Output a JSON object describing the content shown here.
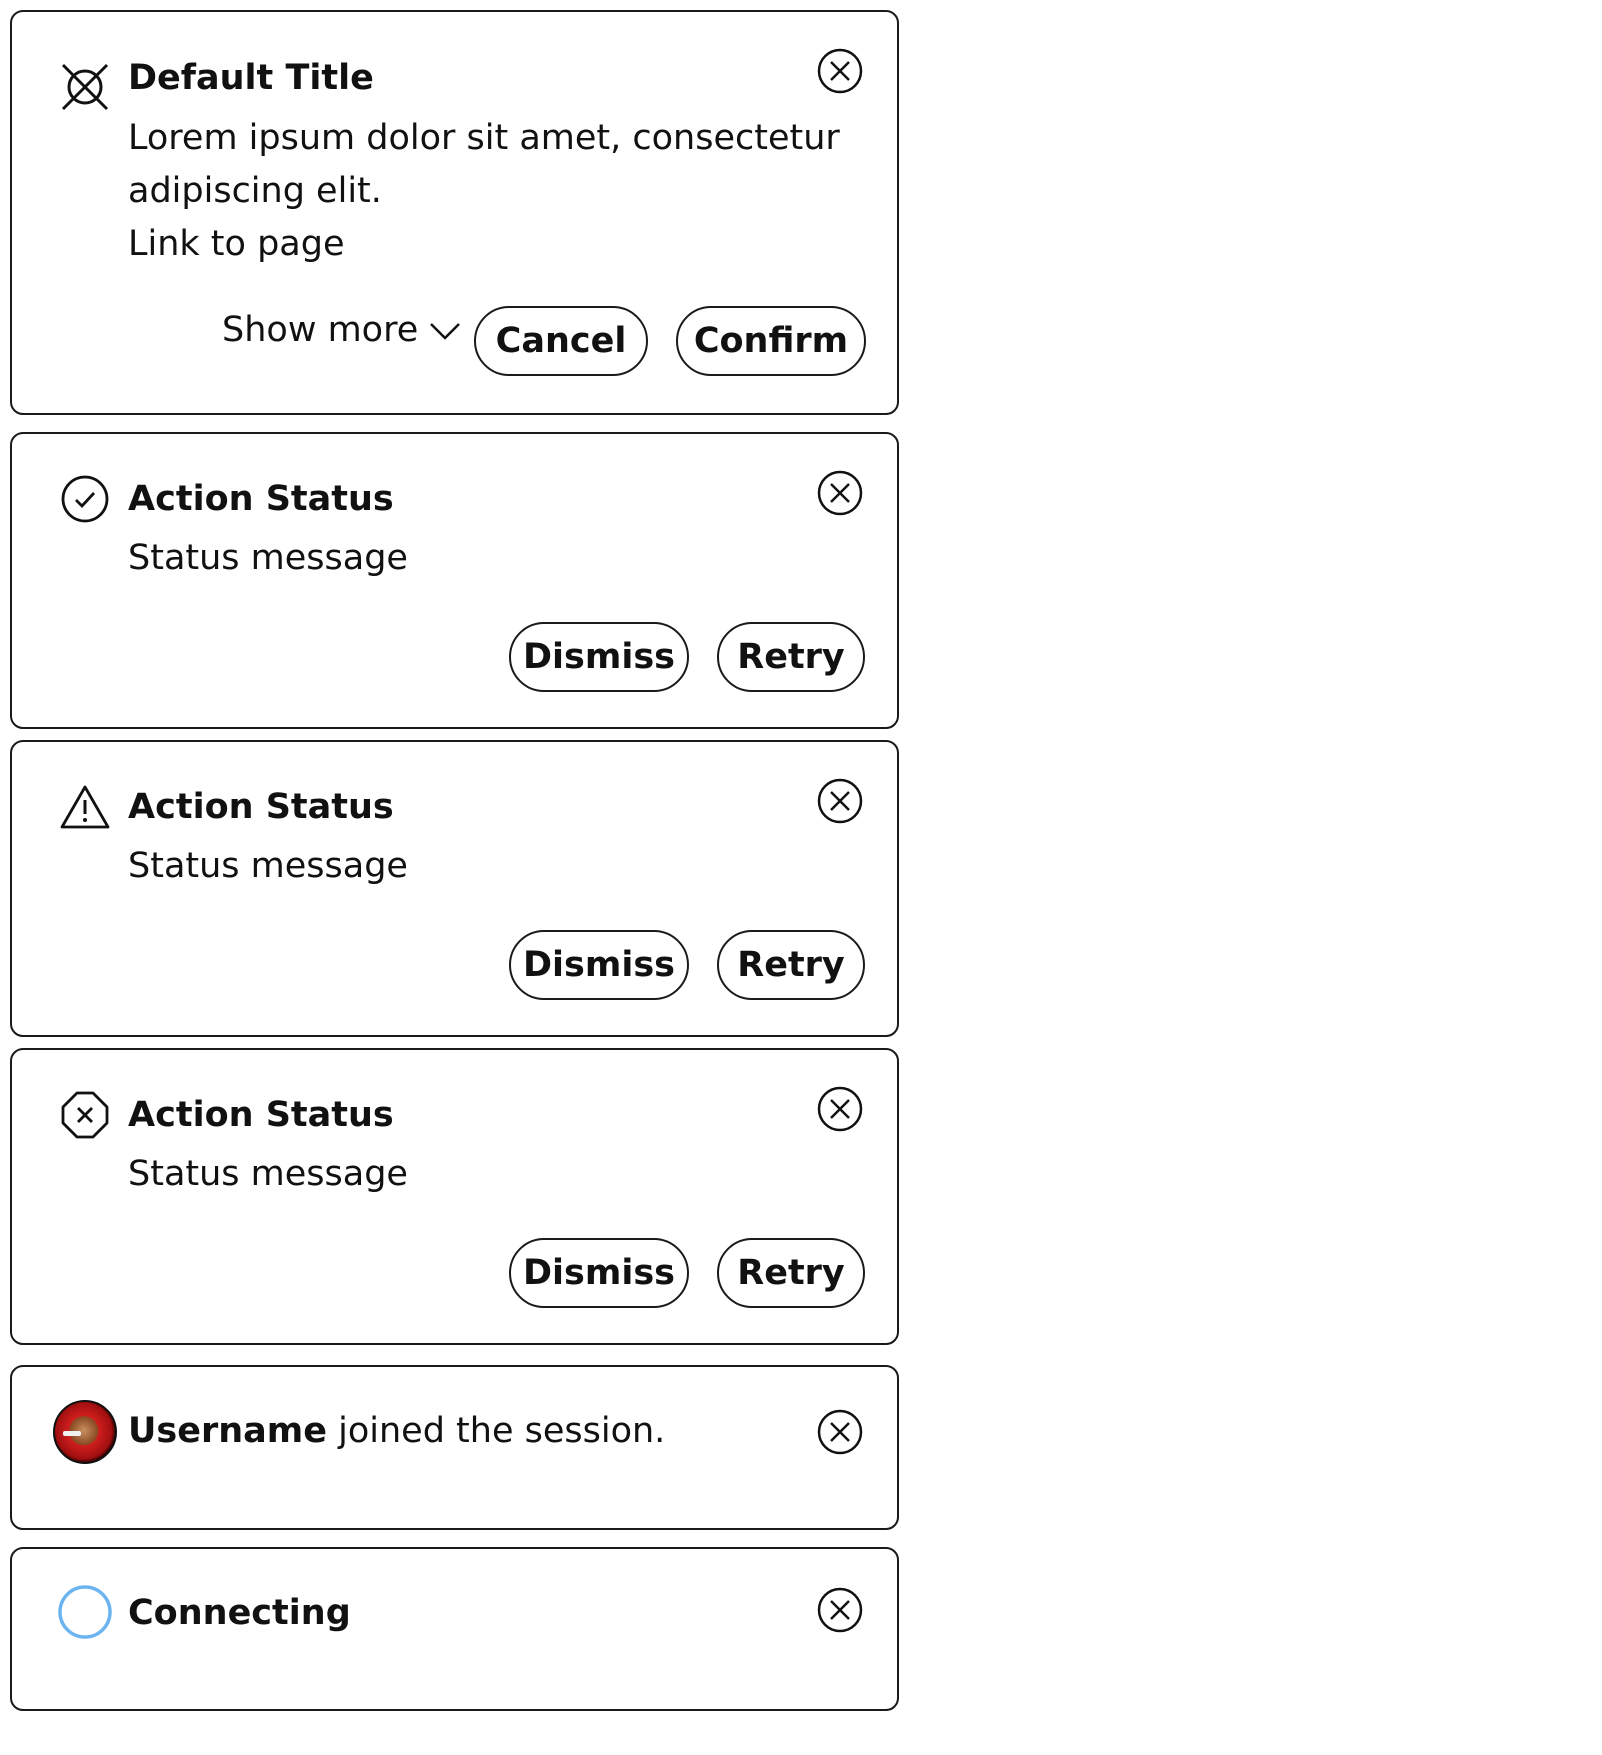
{
  "toasts": {
    "default": {
      "title": "Default Title",
      "message_line1": "Lorem ipsum dolor sit amet, consectetur",
      "message_line2": "adipiscing elit.",
      "link": "Link to page",
      "show_more": "Show more",
      "cancel": "Cancel",
      "confirm": "Confirm",
      "icon": "crossed-circle-icon"
    },
    "success": {
      "title": "Action Status",
      "message": "Status message",
      "dismiss": "Dismiss",
      "retry": "Retry",
      "icon": "check-circle-icon"
    },
    "warning": {
      "title": "Action Status",
      "message": "Status message",
      "dismiss": "Dismiss",
      "retry": "Retry",
      "icon": "warning-triangle-icon"
    },
    "error": {
      "title": "Action Status",
      "message": "Status message",
      "dismiss": "Dismiss",
      "retry": "Retry",
      "icon": "error-octagon-icon"
    },
    "user": {
      "username": "Username",
      "message": "joined the session.",
      "icon": "avatar"
    },
    "connecting": {
      "title": "Connecting",
      "icon": "spinner-ring-icon",
      "spinner_color": "#6cb4f0"
    }
  }
}
